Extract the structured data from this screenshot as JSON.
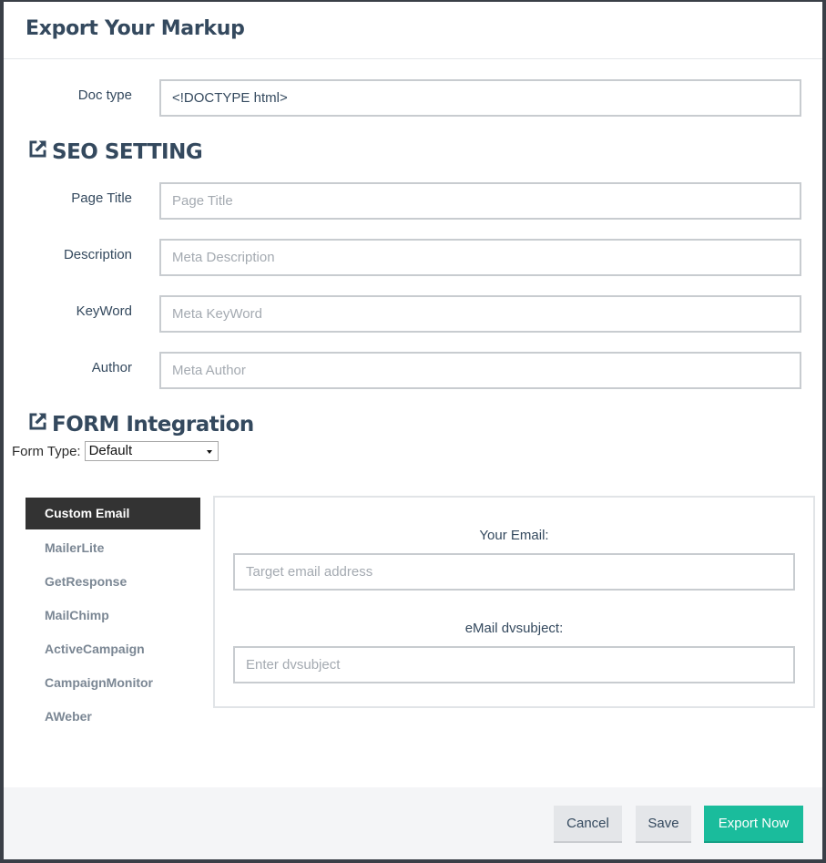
{
  "modal": {
    "title": "Export Your Markup"
  },
  "doctype": {
    "label": "Doc type",
    "value": "<!DOCTYPE html>"
  },
  "seo": {
    "heading": "SEO SETTING",
    "icon": "external-link-icon",
    "fields": {
      "page_title": {
        "label": "Page Title",
        "placeholder": "Page Title"
      },
      "description": {
        "label": "Description",
        "placeholder": "Meta Description"
      },
      "keyword": {
        "label": "KeyWord",
        "placeholder": "Meta KeyWord"
      },
      "author": {
        "label": "Author",
        "placeholder": "Meta Author"
      }
    }
  },
  "form_integration": {
    "heading": "FORM Integration",
    "icon": "external-link-icon",
    "form_type": {
      "label": "Form Type:",
      "selected": "Default"
    },
    "providers": [
      {
        "label": "Custom Email",
        "active": true
      },
      {
        "label": "MailerLite",
        "active": false
      },
      {
        "label": "GetResponse",
        "active": false
      },
      {
        "label": "MailChimp",
        "active": false
      },
      {
        "label": "ActiveCampaign",
        "active": false
      },
      {
        "label": "CampaignMonitor",
        "active": false
      },
      {
        "label": "AWeber",
        "active": false
      }
    ],
    "custom_email": {
      "email_label": "Your Email:",
      "email_placeholder": "Target email address",
      "subject_label": "eMail dvsubject:",
      "subject_placeholder": "Enter dvsubject"
    }
  },
  "footer": {
    "cancel_label": "Cancel",
    "save_label": "Save",
    "export_label": "Export Now"
  },
  "colors": {
    "accent": "#1abc9c",
    "heading": "#34495e",
    "active_tab": "#333333",
    "footer_bg": "#f4f5f7"
  }
}
